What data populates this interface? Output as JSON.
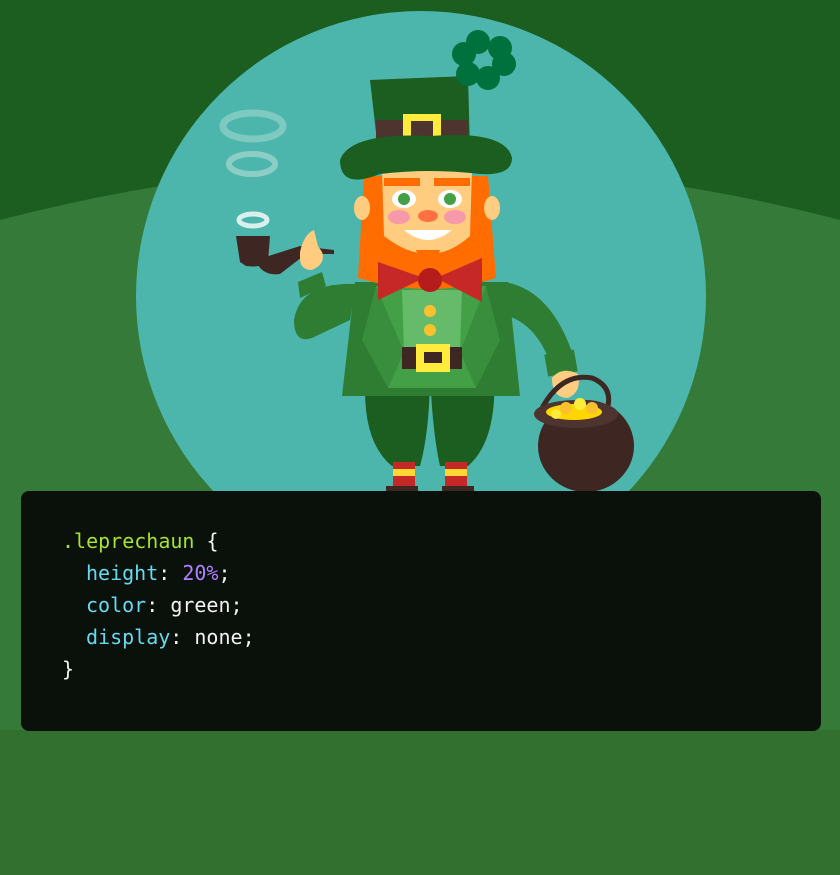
{
  "colors": {
    "sky_green": "#1b5e20",
    "hill_green": "#357a38",
    "moon_teal": "#4db6ac",
    "code_bg": "#0a110b",
    "selector": "#a6e22e",
    "property": "#66d9ef",
    "number": "#ae81ff",
    "text": "#f2f2f2"
  },
  "code": {
    "selector": ".leprechaun",
    "open_brace": " {",
    "close_brace": "}",
    "rules": [
      {
        "property": "height",
        "value": "20%"
      },
      {
        "property": "color",
        "value": "green"
      },
      {
        "property": "display",
        "value": "none"
      }
    ]
  },
  "icons": {
    "character": "leprechaun-illustration",
    "clover": "four-leaf-clover-icon",
    "pipe": "pipe-icon",
    "pot": "pot-of-gold-icon"
  }
}
